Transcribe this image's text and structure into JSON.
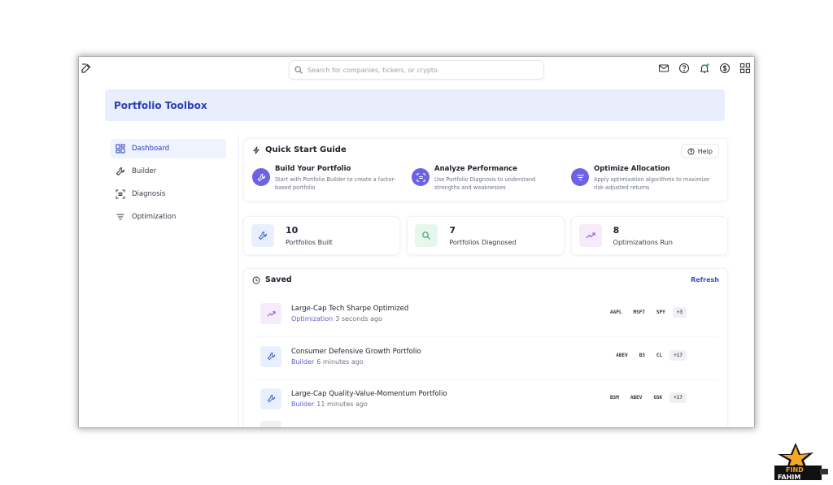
{
  "search": {
    "placeholder": "Search for companies, tickers, or crypto"
  },
  "header": {
    "title": "Portfolio Toolbox"
  },
  "sidebar": {
    "items": [
      {
        "label": "Dashboard",
        "icon": "dashboard-icon",
        "active": true
      },
      {
        "label": "Builder",
        "icon": "wrench-icon"
      },
      {
        "label": "Diagnosis",
        "icon": "scan-icon"
      },
      {
        "label": "Optimization",
        "icon": "filter-icon"
      }
    ]
  },
  "quick_start": {
    "title": "Quick Start Guide",
    "help_label": "Help",
    "steps": [
      {
        "title": "Build Your Portfolio",
        "desc": "Start with Portfolio Builder to create a factor-based portfolio"
      },
      {
        "title": "Analyze Performance",
        "desc": "Use Portfolio Diagnosis to understand strengths and weaknesses"
      },
      {
        "title": "Optimize Allocation",
        "desc": "Apply optimization algorithms to maximize risk-adjusted returns"
      }
    ]
  },
  "stats": [
    {
      "value": "10",
      "label": "Portfolios Built"
    },
    {
      "value": "7",
      "label": "Portfolios Diagnosed"
    },
    {
      "value": "8",
      "label": "Optimizations Run"
    }
  ],
  "saved": {
    "title": "Saved",
    "refresh_label": "Refresh",
    "items": [
      {
        "title": "Large-Cap Tech Sharpe Optimized",
        "kind": "Optimization",
        "time": "3 seconds ago",
        "tags": [
          "AAPL",
          "MSFT",
          "SPY"
        ],
        "more": "+3"
      },
      {
        "title": "Consumer Defensive Growth Portfolio",
        "kind": "Builder",
        "time": "6 minutes ago",
        "tags": [
          "ABEV",
          "B3",
          "CL"
        ],
        "more": "+17"
      },
      {
        "title": "Large-Cap Quality-Value-Momentum Portfolio",
        "kind": "Builder",
        "time": "11 minutes ago",
        "tags": [
          "BSM",
          "ABEV",
          "GSK"
        ],
        "more": "+17"
      }
    ]
  },
  "logo": {
    "line1": "FIND",
    "line2": "FAHIM"
  },
  "colors": {
    "accent": "#2a3db8",
    "step_icon": "#6b63e6",
    "banner": "#e8eefc"
  }
}
